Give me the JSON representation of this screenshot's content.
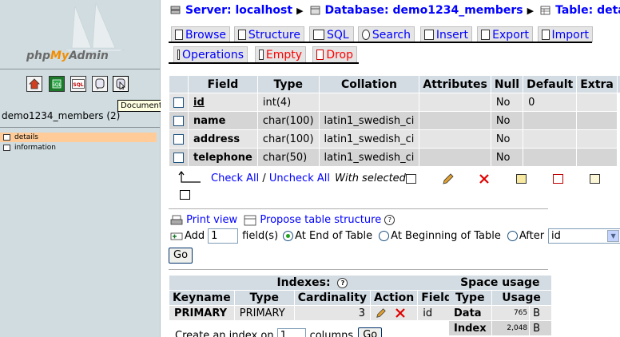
{
  "nav": {
    "logo_parts": [
      "php",
      "My",
      "Admin"
    ],
    "icons": [
      "home-icon",
      "sql-history-icon",
      "sql-query-icon",
      "docs-icon",
      "documentation-icon"
    ],
    "tooltip": "Documentation",
    "db_label": "demo1234_members (2)",
    "tables": [
      {
        "name": "details",
        "active": true
      },
      {
        "name": "information",
        "active": false
      }
    ]
  },
  "breadcrumb": {
    "server": "Server: localhost",
    "database": "Database: demo1234_members",
    "table": "Table: details"
  },
  "tabs": {
    "row1": [
      "Browse",
      "Structure",
      "SQL",
      "Search",
      "Insert",
      "Export",
      "Import"
    ],
    "row2": [
      "Operations",
      "Empty",
      "Drop"
    ]
  },
  "structure": {
    "headers": [
      "Field",
      "Type",
      "Collation",
      "Attributes",
      "Null",
      "Default",
      "Extra"
    ],
    "rows": [
      {
        "field": "id",
        "type": "int(4)",
        "collation": "",
        "attributes": "",
        "null": "No",
        "default": "0",
        "extra": ""
      },
      {
        "field": "name",
        "type": "char(100)",
        "collation": "latin1_swedish_ci",
        "attributes": "",
        "null": "No",
        "default": "",
        "extra": ""
      },
      {
        "field": "address",
        "type": "char(100)",
        "collation": "latin1_swedish_ci",
        "attributes": "",
        "null": "No",
        "default": "",
        "extra": ""
      },
      {
        "field": "telephone",
        "type": "char(50)",
        "collation": "latin1_swedish_ci",
        "attributes": "",
        "null": "No",
        "default": "",
        "extra": ""
      }
    ],
    "check_all": "Check All",
    "separator": " / ",
    "uncheck_all": "Uncheck All",
    "with_selected": "With selected:"
  },
  "actions": {
    "print_view": "Print view",
    "propose": "Propose table structure",
    "add": "Add",
    "add_count": "1",
    "fields_label": "field(s)",
    "at_end": "At End of Table",
    "at_beginning": "At Beginning of Table",
    "after": "After",
    "after_value": "id",
    "go": "Go"
  },
  "indexes": {
    "title": "Indexes:",
    "headers": [
      "Keyname",
      "Type",
      "Cardinality",
      "Action",
      "Field"
    ],
    "rows": [
      {
        "keyname": "PRIMARY",
        "type": "PRIMARY",
        "cardinality": "3",
        "field": "id"
      }
    ],
    "create_label": "Create an index on",
    "create_count": "1",
    "columns_label": "columns",
    "go": "Go"
  },
  "space": {
    "title": "Space usage",
    "headers": [
      "Type",
      "Usage"
    ],
    "rows": [
      {
        "type": "Data",
        "usage": "765",
        "unit": "B"
      },
      {
        "type": "Index",
        "usage": "2,048",
        "unit": "B"
      }
    ]
  },
  "colors": {
    "link": "#0000ff",
    "header_bg": "#d3dce3",
    "active_table": "#ffcc99",
    "nav_bg": "#d0dce0"
  }
}
